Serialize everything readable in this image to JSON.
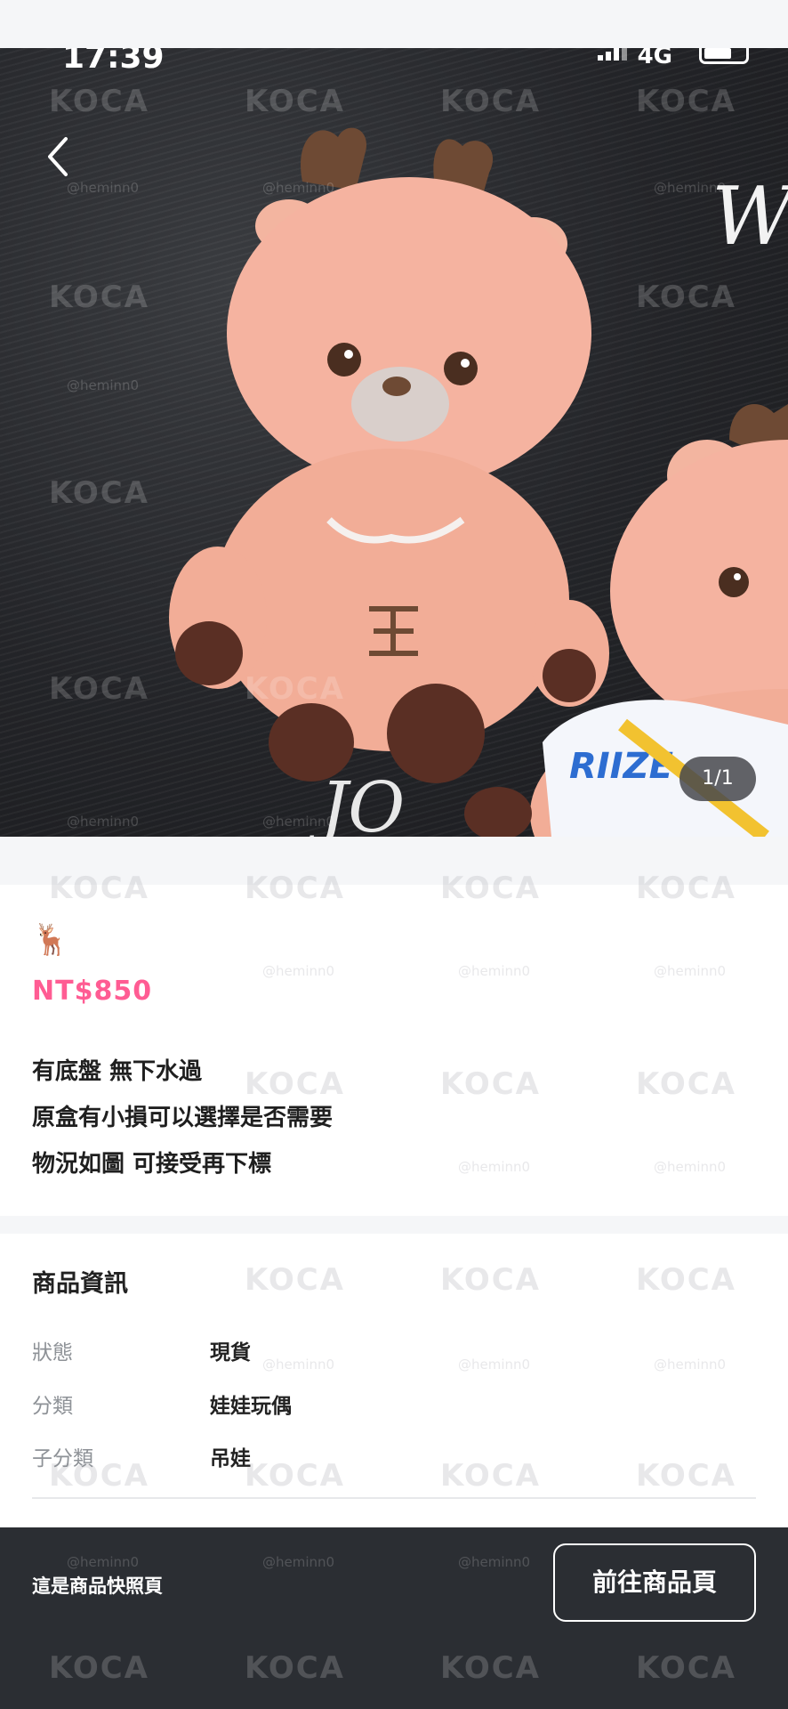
{
  "status_bar": {
    "time": "17:39",
    "network": "4G"
  },
  "gallery": {
    "counter": "1/1"
  },
  "product": {
    "emoji": "🦌",
    "price": "NT$850",
    "description": [
      "有底盤 無下水過",
      "原盒有小損可以選擇是否需要",
      "物況如圖 可接受再下標"
    ]
  },
  "spec": {
    "title": "商品資訊",
    "rows": [
      {
        "key": "狀態",
        "value": "現貨"
      },
      {
        "key": "分類",
        "value": "娃娃玩偶"
      },
      {
        "key": "子分類",
        "value": "吊娃"
      }
    ]
  },
  "photo_text": {
    "hoodie_text": "RIIZE",
    "print_text": "JO"
  },
  "watermark": {
    "logo": "KOCA",
    "handle": "@heminn0"
  },
  "footer": {
    "snapshot_label": "這是商品快照頁",
    "goto_button": "前往商品頁"
  },
  "colors": {
    "price": "#ff5c93",
    "bottom_bar": "#2b2e33",
    "accent_dark": "#1a1b1e"
  }
}
